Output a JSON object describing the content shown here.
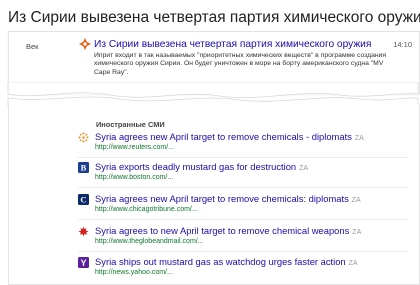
{
  "page": {
    "title": "Из Сирии вывезена четвертая партия химического оружия"
  },
  "top_story": {
    "source": "Век",
    "headline": "Из Сирии вывезена четвертая партия химического оружия",
    "time": "14:10",
    "snippet": "Иприт входит в так называемых \"приоритетных химических веществ\" в программе создания химического оружия Сирии. Он будет уничтожен в море на борту американского судна \"MV Cape Ray\"."
  },
  "related": {
    "header": "Иностранные СМИ",
    "za_label": "ZA",
    "stories": [
      {
        "icon": "reuters-favicon-icon",
        "headline": "Syria agrees new April target to remove chemicals - diplomats",
        "url": "http://www.reuters.com/..."
      },
      {
        "icon": "boston-globe-favicon-icon",
        "headline": "Syria exports deadly mustard gas for destruction",
        "url": "http://www.boston.com/..."
      },
      {
        "icon": "chicago-tribune-favicon-icon",
        "headline": "Syria agrees new April target to remove chemicals: diplomats",
        "url": "http://www.chicagotribune.com/..."
      },
      {
        "icon": "globe-and-mail-favicon-icon",
        "headline": "Syria agrees to new April target to remove chemical weapons",
        "url": "http://www.theglobeandmail.com/..."
      },
      {
        "icon": "yahoo-favicon-icon",
        "headline": "Syria ships out mustard gas as watchdog urges faster action",
        "url": "http://news.yahoo.com/..."
      }
    ]
  },
  "colors": {
    "link": "#1a0dab",
    "url": "#0a7a2a",
    "lenta_orange": "#e8611c"
  }
}
